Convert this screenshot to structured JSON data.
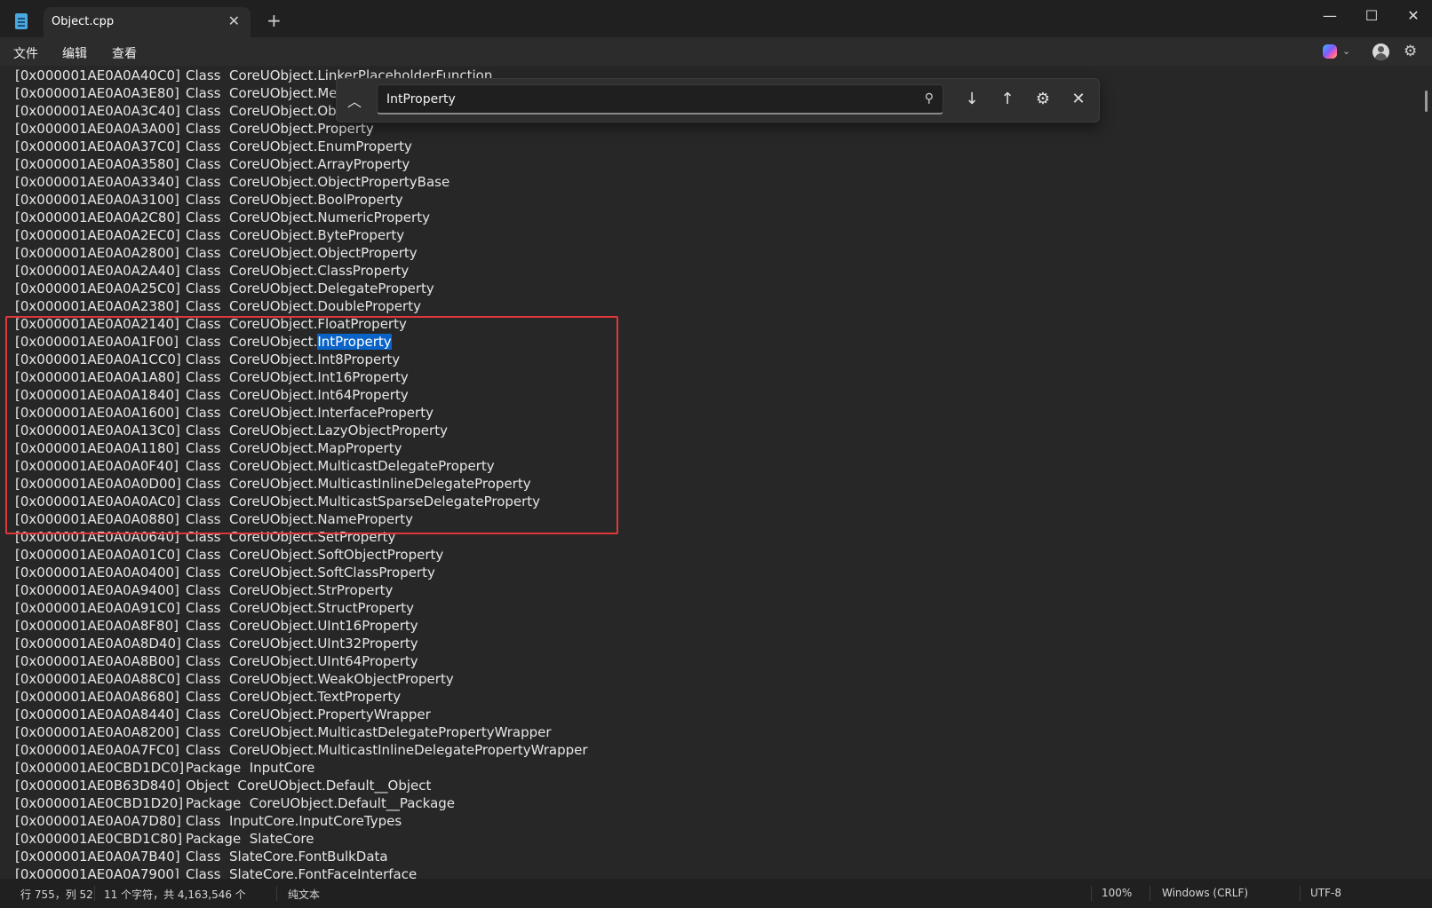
{
  "titlebar": {
    "tab_title": "Object.cpp",
    "tab_close": "✕",
    "tab_add": "+",
    "minimize": "—",
    "maximize": "☐",
    "close": "✕"
  },
  "menu": [
    "文件",
    "编辑",
    "查看"
  ],
  "find": {
    "query": "IntProperty",
    "collapse_icon": "︿",
    "search_icon": "⚲",
    "next_icon": "↓",
    "prev_icon": "↑",
    "options_icon": "⚙",
    "close_icon": "✕"
  },
  "lines": [
    {
      "addr": "[0x000001AE0A0A40C0]",
      "kind": "Class",
      "name": "CoreUObject.LinkerPlaceholderFunction"
    },
    {
      "addr": "[0x000001AE0A0A3E80]",
      "kind": "Class",
      "name": "CoreUObject.Me"
    },
    {
      "addr": "[0x000001AE0A0A3C40]",
      "kind": "Class",
      "name": "CoreUObject.Obj"
    },
    {
      "addr": "[0x000001AE0A0A3A00]",
      "kind": "Class",
      "name": "CoreUObject.Property"
    },
    {
      "addr": "[0x000001AE0A0A37C0]",
      "kind": "Class",
      "name": "CoreUObject.EnumProperty"
    },
    {
      "addr": "[0x000001AE0A0A3580]",
      "kind": "Class",
      "name": "CoreUObject.ArrayProperty"
    },
    {
      "addr": "[0x000001AE0A0A3340]",
      "kind": "Class",
      "name": "CoreUObject.ObjectPropertyBase"
    },
    {
      "addr": "[0x000001AE0A0A3100]",
      "kind": "Class",
      "name": "CoreUObject.BoolProperty"
    },
    {
      "addr": "[0x000001AE0A0A2C80]",
      "kind": "Class",
      "name": "CoreUObject.NumericProperty"
    },
    {
      "addr": "[0x000001AE0A0A2EC0]",
      "kind": "Class",
      "name": "CoreUObject.ByteProperty"
    },
    {
      "addr": "[0x000001AE0A0A2800]",
      "kind": "Class",
      "name": "CoreUObject.ObjectProperty"
    },
    {
      "addr": "[0x000001AE0A0A2A40]",
      "kind": "Class",
      "name": "CoreUObject.ClassProperty"
    },
    {
      "addr": "[0x000001AE0A0A25C0]",
      "kind": "Class",
      "name": "CoreUObject.DelegateProperty"
    },
    {
      "addr": "[0x000001AE0A0A2380]",
      "kind": "Class",
      "name": "CoreUObject.DoubleProperty"
    },
    {
      "addr": "[0x000001AE0A0A2140]",
      "kind": "Class",
      "name": "CoreUObject.FloatProperty"
    },
    {
      "addr": "[0x000001AE0A0A1F00]",
      "kind": "Class",
      "name": "CoreUObject.",
      "match": "IntProperty"
    },
    {
      "addr": "[0x000001AE0A0A1CC0]",
      "kind": "Class",
      "name": "CoreUObject.Int8Property"
    },
    {
      "addr": "[0x000001AE0A0A1A80]",
      "kind": "Class",
      "name": "CoreUObject.Int16Property"
    },
    {
      "addr": "[0x000001AE0A0A1840]",
      "kind": "Class",
      "name": "CoreUObject.Int64Property"
    },
    {
      "addr": "[0x000001AE0A0A1600]",
      "kind": "Class",
      "name": "CoreUObject.InterfaceProperty"
    },
    {
      "addr": "[0x000001AE0A0A13C0]",
      "kind": "Class",
      "name": "CoreUObject.LazyObjectProperty"
    },
    {
      "addr": "[0x000001AE0A0A1180]",
      "kind": "Class",
      "name": "CoreUObject.MapProperty"
    },
    {
      "addr": "[0x000001AE0A0A0F40]",
      "kind": "Class",
      "name": "CoreUObject.MulticastDelegateProperty"
    },
    {
      "addr": "[0x000001AE0A0A0D00]",
      "kind": "Class",
      "name": "CoreUObject.MulticastInlineDelegateProperty"
    },
    {
      "addr": "[0x000001AE0A0A0AC0]",
      "kind": "Class",
      "name": "CoreUObject.MulticastSparseDelegateProperty"
    },
    {
      "addr": "[0x000001AE0A0A0880]",
      "kind": "Class",
      "name": "CoreUObject.NameProperty"
    },
    {
      "addr": "[0x000001AE0A0A0640]",
      "kind": "Class",
      "name": "CoreUObject.SetProperty"
    },
    {
      "addr": "[0x000001AE0A0A01C0]",
      "kind": "Class",
      "name": "CoreUObject.SoftObjectProperty"
    },
    {
      "addr": "[0x000001AE0A0A0400]",
      "kind": "Class",
      "name": "CoreUObject.SoftClassProperty"
    },
    {
      "addr": "[0x000001AE0A0A9400]",
      "kind": "Class",
      "name": "CoreUObject.StrProperty"
    },
    {
      "addr": "[0x000001AE0A0A91C0]",
      "kind": "Class",
      "name": "CoreUObject.StructProperty"
    },
    {
      "addr": "[0x000001AE0A0A8F80]",
      "kind": "Class",
      "name": "CoreUObject.UInt16Property"
    },
    {
      "addr": "[0x000001AE0A0A8D40]",
      "kind": "Class",
      "name": "CoreUObject.UInt32Property"
    },
    {
      "addr": "[0x000001AE0A0A8B00]",
      "kind": "Class",
      "name": "CoreUObject.UInt64Property"
    },
    {
      "addr": "[0x000001AE0A0A88C0]",
      "kind": "Class",
      "name": "CoreUObject.WeakObjectProperty"
    },
    {
      "addr": "[0x000001AE0A0A8680]",
      "kind": "Class",
      "name": "CoreUObject.TextProperty"
    },
    {
      "addr": "[0x000001AE0A0A8440]",
      "kind": "Class",
      "name": "CoreUObject.PropertyWrapper"
    },
    {
      "addr": "[0x000001AE0A0A8200]",
      "kind": "Class",
      "name": "CoreUObject.MulticastDelegatePropertyWrapper"
    },
    {
      "addr": "[0x000001AE0A0A7FC0]",
      "kind": "Class",
      "name": "CoreUObject.MulticastInlineDelegatePropertyWrapper"
    },
    {
      "addr": "[0x000001AE0CBD1DC0]",
      "kind": "Package",
      "name": "InputCore"
    },
    {
      "addr": "[0x000001AE0B63D840]",
      "kind": "Object",
      "name": "CoreUObject.Default__Object"
    },
    {
      "addr": "[0x000001AE0CBD1D20]",
      "kind": "Package",
      "name": "CoreUObject.Default__Package"
    },
    {
      "addr": "[0x000001AE0A0A7D80]",
      "kind": "Class",
      "name": "InputCore.InputCoreTypes"
    },
    {
      "addr": "[0x000001AE0CBD1C80]",
      "kind": "Package",
      "name": "SlateCore"
    },
    {
      "addr": "[0x000001AE0A0A7B40]",
      "kind": "Class",
      "name": "SlateCore.FontBulkData"
    },
    {
      "addr": "[0x000001AE0A0A7900]",
      "kind": "Class",
      "name": "SlateCore.FontFaceInterface"
    }
  ],
  "status": {
    "position": "行 755，列 52",
    "selection": "11 个字符，共 4,163,546 个",
    "format": "纯文本",
    "zoom": "100%",
    "line_ending": "Windows (CRLF)",
    "encoding": "UTF-8"
  }
}
